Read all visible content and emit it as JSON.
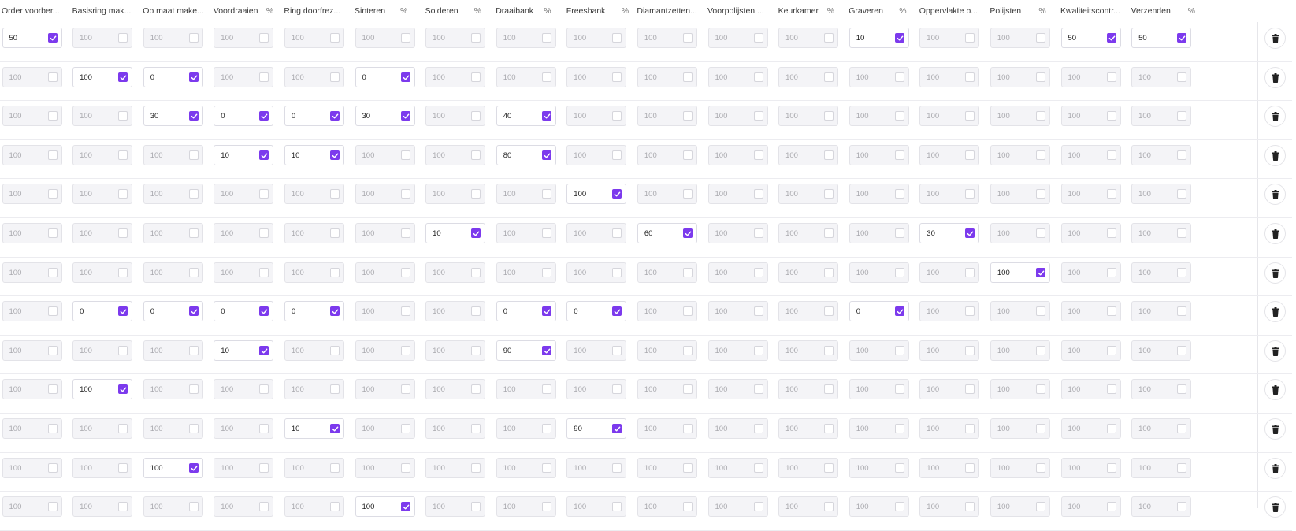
{
  "columns": [
    {
      "name": "Order voorber...",
      "pct": ""
    },
    {
      "name": "Basisring mak...",
      "pct": ""
    },
    {
      "name": "Op maat make...",
      "pct": ""
    },
    {
      "name": "Voordraaien",
      "pct": "%"
    },
    {
      "name": "Ring doorfrez...",
      "pct": ""
    },
    {
      "name": "Sinteren",
      "pct": "%"
    },
    {
      "name": "Solderen",
      "pct": "%"
    },
    {
      "name": "Draaibank",
      "pct": "%"
    },
    {
      "name": "Freesbank",
      "pct": "%"
    },
    {
      "name": "Diamantzetten...",
      "pct": ""
    },
    {
      "name": "Voorpolijsten ...",
      "pct": ""
    },
    {
      "name": "Keurkamer",
      "pct": "%"
    },
    {
      "name": "Graveren",
      "pct": "%"
    },
    {
      "name": "Oppervlakte b...",
      "pct": ""
    },
    {
      "name": "Polijsten",
      "pct": "%"
    },
    {
      "name": "Kwaliteitscontr...",
      "pct": ""
    },
    {
      "name": "Verzenden",
      "pct": "%"
    }
  ],
  "colors": {
    "accent": "#7c3aed"
  },
  "delete_icon": "trash-icon",
  "checkbox_icon": "check-icon",
  "rows": [
    [
      {
        "v": "50",
        "on": true
      },
      {
        "v": "100",
        "on": false
      },
      {
        "v": "100",
        "on": false
      },
      {
        "v": "100",
        "on": false
      },
      {
        "v": "100",
        "on": false
      },
      {
        "v": "100",
        "on": false
      },
      {
        "v": "100",
        "on": false
      },
      {
        "v": "100",
        "on": false
      },
      {
        "v": "100",
        "on": false
      },
      {
        "v": "100",
        "on": false
      },
      {
        "v": "100",
        "on": false
      },
      {
        "v": "100",
        "on": false
      },
      {
        "v": "10",
        "on": true
      },
      {
        "v": "100",
        "on": false
      },
      {
        "v": "100",
        "on": false
      },
      {
        "v": "50",
        "on": true
      },
      {
        "v": "50",
        "on": true
      }
    ],
    [
      {
        "v": "100",
        "on": false
      },
      {
        "v": "100",
        "on": true
      },
      {
        "v": "0",
        "on": true
      },
      {
        "v": "100",
        "on": false
      },
      {
        "v": "100",
        "on": false
      },
      {
        "v": "0",
        "on": true
      },
      {
        "v": "100",
        "on": false
      },
      {
        "v": "100",
        "on": false
      },
      {
        "v": "100",
        "on": false
      },
      {
        "v": "100",
        "on": false
      },
      {
        "v": "100",
        "on": false
      },
      {
        "v": "100",
        "on": false
      },
      {
        "v": "100",
        "on": false
      },
      {
        "v": "100",
        "on": false
      },
      {
        "v": "100",
        "on": false
      },
      {
        "v": "100",
        "on": false
      },
      {
        "v": "100",
        "on": false
      }
    ],
    [
      {
        "v": "100",
        "on": false
      },
      {
        "v": "100",
        "on": false
      },
      {
        "v": "30",
        "on": true
      },
      {
        "v": "0",
        "on": true
      },
      {
        "v": "0",
        "on": true
      },
      {
        "v": "30",
        "on": true
      },
      {
        "v": "100",
        "on": false
      },
      {
        "v": "40",
        "on": true
      },
      {
        "v": "100",
        "on": false
      },
      {
        "v": "100",
        "on": false
      },
      {
        "v": "100",
        "on": false
      },
      {
        "v": "100",
        "on": false
      },
      {
        "v": "100",
        "on": false
      },
      {
        "v": "100",
        "on": false
      },
      {
        "v": "100",
        "on": false
      },
      {
        "v": "100",
        "on": false
      },
      {
        "v": "100",
        "on": false
      }
    ],
    [
      {
        "v": "100",
        "on": false
      },
      {
        "v": "100",
        "on": false
      },
      {
        "v": "100",
        "on": false
      },
      {
        "v": "10",
        "on": true
      },
      {
        "v": "10",
        "on": true
      },
      {
        "v": "100",
        "on": false
      },
      {
        "v": "100",
        "on": false
      },
      {
        "v": "80",
        "on": true
      },
      {
        "v": "100",
        "on": false
      },
      {
        "v": "100",
        "on": false
      },
      {
        "v": "100",
        "on": false
      },
      {
        "v": "100",
        "on": false
      },
      {
        "v": "100",
        "on": false
      },
      {
        "v": "100",
        "on": false
      },
      {
        "v": "100",
        "on": false
      },
      {
        "v": "100",
        "on": false
      },
      {
        "v": "100",
        "on": false
      }
    ],
    [
      {
        "v": "100",
        "on": false
      },
      {
        "v": "100",
        "on": false
      },
      {
        "v": "100",
        "on": false
      },
      {
        "v": "100",
        "on": false
      },
      {
        "v": "100",
        "on": false
      },
      {
        "v": "100",
        "on": false
      },
      {
        "v": "100",
        "on": false
      },
      {
        "v": "100",
        "on": false
      },
      {
        "v": "100",
        "on": true
      },
      {
        "v": "100",
        "on": false
      },
      {
        "v": "100",
        "on": false
      },
      {
        "v": "100",
        "on": false
      },
      {
        "v": "100",
        "on": false
      },
      {
        "v": "100",
        "on": false
      },
      {
        "v": "100",
        "on": false
      },
      {
        "v": "100",
        "on": false
      },
      {
        "v": "100",
        "on": false
      }
    ],
    [
      {
        "v": "100",
        "on": false
      },
      {
        "v": "100",
        "on": false
      },
      {
        "v": "100",
        "on": false
      },
      {
        "v": "100",
        "on": false
      },
      {
        "v": "100",
        "on": false
      },
      {
        "v": "100",
        "on": false
      },
      {
        "v": "10",
        "on": true
      },
      {
        "v": "100",
        "on": false
      },
      {
        "v": "100",
        "on": false
      },
      {
        "v": "60",
        "on": true
      },
      {
        "v": "100",
        "on": false
      },
      {
        "v": "100",
        "on": false
      },
      {
        "v": "100",
        "on": false
      },
      {
        "v": "30",
        "on": true
      },
      {
        "v": "100",
        "on": false
      },
      {
        "v": "100",
        "on": false
      },
      {
        "v": "100",
        "on": false
      }
    ],
    [
      {
        "v": "100",
        "on": false
      },
      {
        "v": "100",
        "on": false
      },
      {
        "v": "100",
        "on": false
      },
      {
        "v": "100",
        "on": false
      },
      {
        "v": "100",
        "on": false
      },
      {
        "v": "100",
        "on": false
      },
      {
        "v": "100",
        "on": false
      },
      {
        "v": "100",
        "on": false
      },
      {
        "v": "100",
        "on": false
      },
      {
        "v": "100",
        "on": false
      },
      {
        "v": "100",
        "on": false
      },
      {
        "v": "100",
        "on": false
      },
      {
        "v": "100",
        "on": false
      },
      {
        "v": "100",
        "on": false
      },
      {
        "v": "100",
        "on": true
      },
      {
        "v": "100",
        "on": false
      },
      {
        "v": "100",
        "on": false
      }
    ],
    [
      {
        "v": "100",
        "on": false
      },
      {
        "v": "0",
        "on": true
      },
      {
        "v": "0",
        "on": true
      },
      {
        "v": "0",
        "on": true
      },
      {
        "v": "0",
        "on": true
      },
      {
        "v": "100",
        "on": false
      },
      {
        "v": "100",
        "on": false
      },
      {
        "v": "0",
        "on": true
      },
      {
        "v": "0",
        "on": true
      },
      {
        "v": "100",
        "on": false
      },
      {
        "v": "100",
        "on": false
      },
      {
        "v": "100",
        "on": false
      },
      {
        "v": "0",
        "on": true
      },
      {
        "v": "100",
        "on": false
      },
      {
        "v": "100",
        "on": false
      },
      {
        "v": "100",
        "on": false
      },
      {
        "v": "100",
        "on": false
      }
    ],
    [
      {
        "v": "100",
        "on": false
      },
      {
        "v": "100",
        "on": false
      },
      {
        "v": "100",
        "on": false
      },
      {
        "v": "10",
        "on": true
      },
      {
        "v": "100",
        "on": false
      },
      {
        "v": "100",
        "on": false
      },
      {
        "v": "100",
        "on": false
      },
      {
        "v": "90",
        "on": true
      },
      {
        "v": "100",
        "on": false
      },
      {
        "v": "100",
        "on": false
      },
      {
        "v": "100",
        "on": false
      },
      {
        "v": "100",
        "on": false
      },
      {
        "v": "100",
        "on": false
      },
      {
        "v": "100",
        "on": false
      },
      {
        "v": "100",
        "on": false
      },
      {
        "v": "100",
        "on": false
      },
      {
        "v": "100",
        "on": false
      }
    ],
    [
      {
        "v": "100",
        "on": false
      },
      {
        "v": "100",
        "on": true
      },
      {
        "v": "100",
        "on": false
      },
      {
        "v": "100",
        "on": false
      },
      {
        "v": "100",
        "on": false
      },
      {
        "v": "100",
        "on": false
      },
      {
        "v": "100",
        "on": false
      },
      {
        "v": "100",
        "on": false
      },
      {
        "v": "100",
        "on": false
      },
      {
        "v": "100",
        "on": false
      },
      {
        "v": "100",
        "on": false
      },
      {
        "v": "100",
        "on": false
      },
      {
        "v": "100",
        "on": false
      },
      {
        "v": "100",
        "on": false
      },
      {
        "v": "100",
        "on": false
      },
      {
        "v": "100",
        "on": false
      },
      {
        "v": "100",
        "on": false
      }
    ],
    [
      {
        "v": "100",
        "on": false
      },
      {
        "v": "100",
        "on": false
      },
      {
        "v": "100",
        "on": false
      },
      {
        "v": "100",
        "on": false
      },
      {
        "v": "10",
        "on": true
      },
      {
        "v": "100",
        "on": false
      },
      {
        "v": "100",
        "on": false
      },
      {
        "v": "100",
        "on": false
      },
      {
        "v": "90",
        "on": true
      },
      {
        "v": "100",
        "on": false
      },
      {
        "v": "100",
        "on": false
      },
      {
        "v": "100",
        "on": false
      },
      {
        "v": "100",
        "on": false
      },
      {
        "v": "100",
        "on": false
      },
      {
        "v": "100",
        "on": false
      },
      {
        "v": "100",
        "on": false
      },
      {
        "v": "100",
        "on": false
      }
    ],
    [
      {
        "v": "100",
        "on": false
      },
      {
        "v": "100",
        "on": false
      },
      {
        "v": "100",
        "on": true
      },
      {
        "v": "100",
        "on": false
      },
      {
        "v": "100",
        "on": false
      },
      {
        "v": "100",
        "on": false
      },
      {
        "v": "100",
        "on": false
      },
      {
        "v": "100",
        "on": false
      },
      {
        "v": "100",
        "on": false
      },
      {
        "v": "100",
        "on": false
      },
      {
        "v": "100",
        "on": false
      },
      {
        "v": "100",
        "on": false
      },
      {
        "v": "100",
        "on": false
      },
      {
        "v": "100",
        "on": false
      },
      {
        "v": "100",
        "on": false
      },
      {
        "v": "100",
        "on": false
      },
      {
        "v": "100",
        "on": false
      }
    ],
    [
      {
        "v": "100",
        "on": false
      },
      {
        "v": "100",
        "on": false
      },
      {
        "v": "100",
        "on": false
      },
      {
        "v": "100",
        "on": false
      },
      {
        "v": "100",
        "on": false
      },
      {
        "v": "100",
        "on": true
      },
      {
        "v": "100",
        "on": false
      },
      {
        "v": "100",
        "on": false
      },
      {
        "v": "100",
        "on": false
      },
      {
        "v": "100",
        "on": false
      },
      {
        "v": "100",
        "on": false
      },
      {
        "v": "100",
        "on": false
      },
      {
        "v": "100",
        "on": false
      },
      {
        "v": "100",
        "on": false
      },
      {
        "v": "100",
        "on": false
      },
      {
        "v": "100",
        "on": false
      },
      {
        "v": "100",
        "on": false
      }
    ]
  ]
}
